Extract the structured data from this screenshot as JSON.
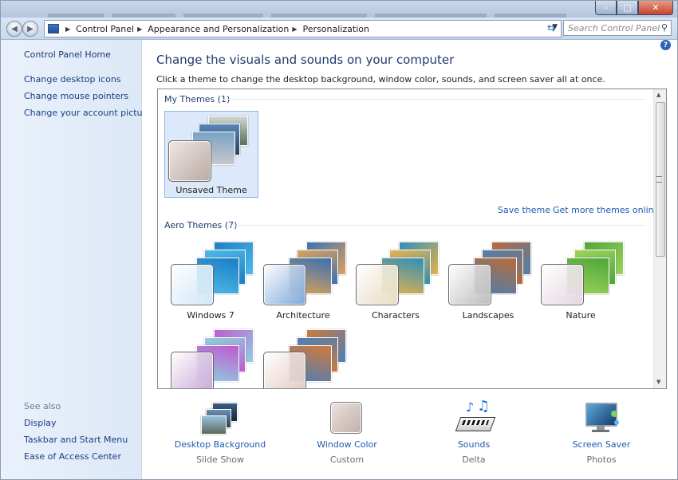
{
  "window": {
    "minimize": "–",
    "maximize": "□",
    "close": "✕"
  },
  "address": {
    "breadcrumbs": [
      "Control Panel",
      "Appearance and Personalization",
      "Personalization"
    ],
    "search_placeholder": "Search Control Panel"
  },
  "leftnav": {
    "home": "Control Panel Home",
    "tasks": [
      "Change desktop icons",
      "Change mouse pointers",
      "Change your account picture"
    ],
    "see_also_label": "See also",
    "see_also": [
      "Display",
      "Taskbar and Start Menu",
      "Ease of Access Center"
    ]
  },
  "main": {
    "title": "Change the visuals and sounds on your computer",
    "description": "Click a theme to change the desktop background, window color, sounds, and screen saver all at once.",
    "my_themes_label": "My Themes (1)",
    "my_themes": [
      {
        "name": "Unsaved Theme"
      }
    ],
    "save_theme": "Save theme",
    "get_more": "Get more themes online",
    "aero_label": "Aero Themes (7)",
    "aero_themes": [
      {
        "name": "Windows 7",
        "colors": [
          "#1a7fc4",
          "#4fb8e8"
        ],
        "glass": "#cfe6f7"
      },
      {
        "name": "Architecture",
        "colors": [
          "#3b6fb5",
          "#d9a25a"
        ],
        "glass": "#7ba7dc"
      },
      {
        "name": "Characters",
        "colors": [
          "#2c8fb8",
          "#e6b34d"
        ],
        "glass": "#e7dcc2"
      },
      {
        "name": "Landscapes",
        "colors": [
          "#b86a3a",
          "#4f7fae"
        ],
        "glass": "#bcbcbc"
      },
      {
        "name": "Nature",
        "colors": [
          "#4ea63a",
          "#9bd35a"
        ],
        "glass": "#e5d5e0"
      },
      {
        "name": "",
        "colors": [
          "#c05ad0",
          "#8ed0e0"
        ],
        "glass": "#c9a6d6"
      },
      {
        "name": "",
        "colors": [
          "#d27a3a",
          "#4a7eb8"
        ],
        "glass": "#e3c9c2"
      }
    ]
  },
  "bottom": [
    {
      "label": "Desktop Background",
      "sub": "Slide Show",
      "icon": "desktop-background-icon"
    },
    {
      "label": "Window Color",
      "sub": "Custom",
      "icon": "window-color-icon"
    },
    {
      "label": "Sounds",
      "sub": "Delta",
      "icon": "sounds-icon"
    },
    {
      "label": "Screen Saver",
      "sub": "Photos",
      "icon": "screen-saver-icon"
    }
  ],
  "help_glyph": "?"
}
